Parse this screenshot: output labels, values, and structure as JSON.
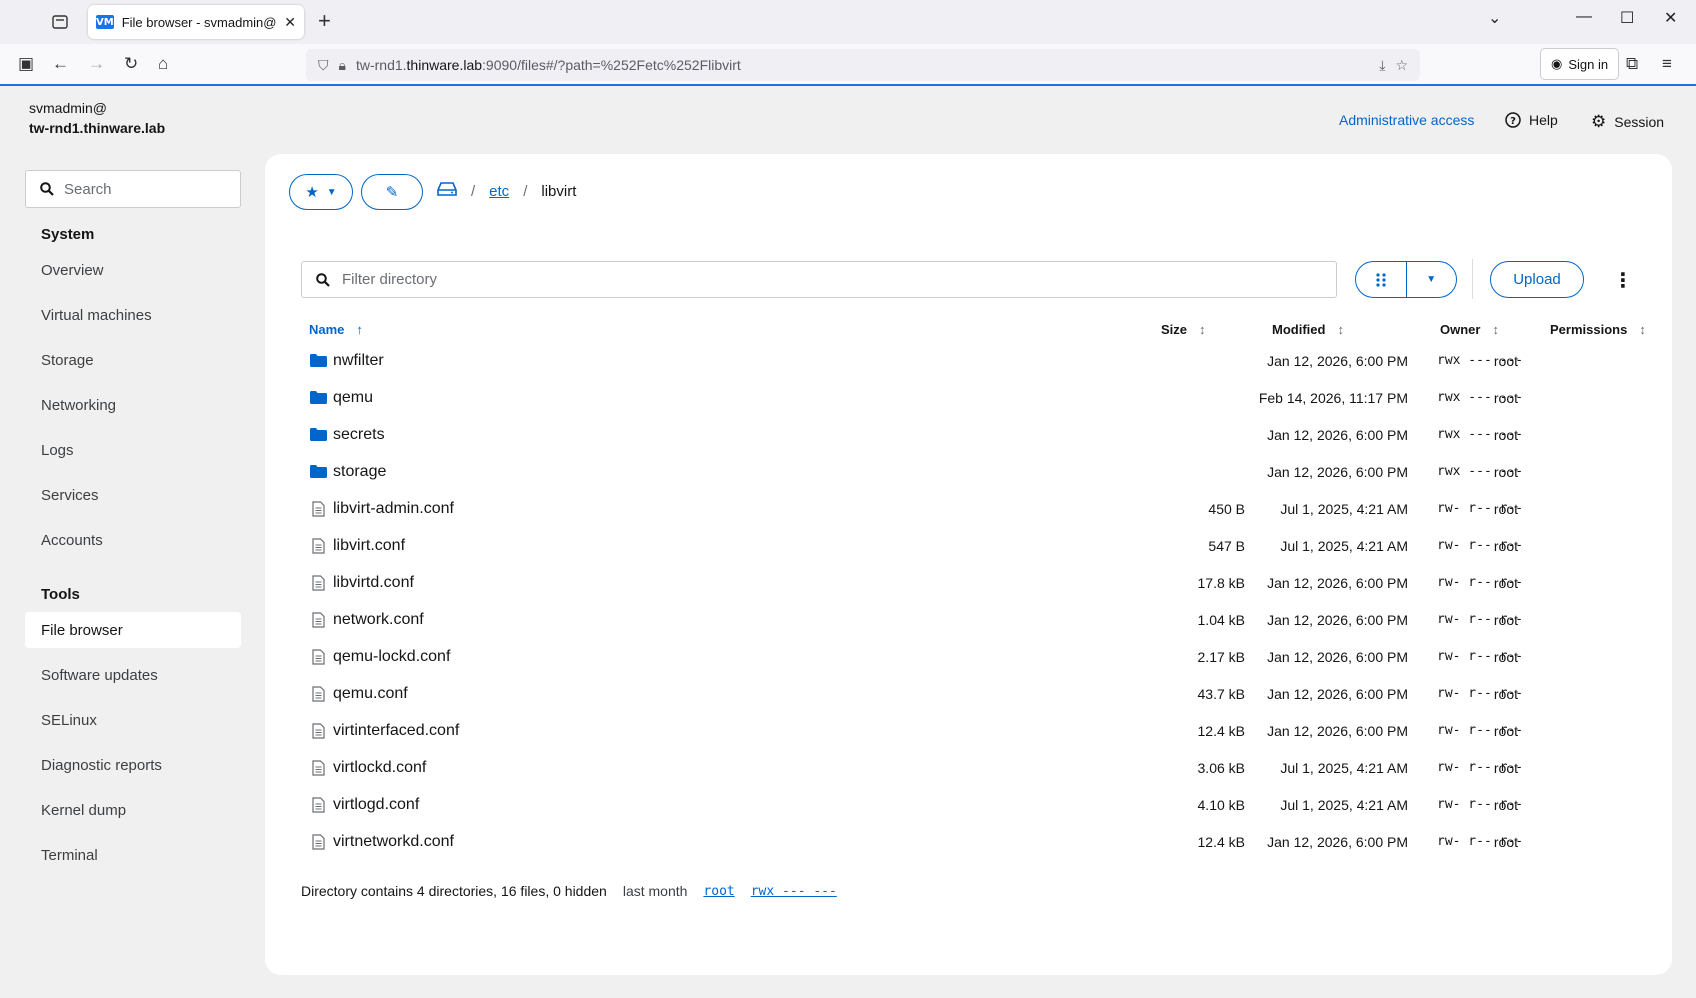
{
  "browser": {
    "tab_title": "File browser - svmadmin@tw-rr",
    "favicon_text": "VM",
    "url_prefix": "tw-rnd1.",
    "url_host": "thinware.lab",
    "url_rest": ":9090/files#/?path=%252Fetc%252Flibvirt",
    "signin_label": "Sign in"
  },
  "header": {
    "user": "svmadmin@",
    "host": "tw-rnd1.thinware.lab",
    "admin_access": "Administrative access",
    "help": "Help",
    "session": "Session"
  },
  "sidebar": {
    "search_placeholder": "Search",
    "system_label": "System",
    "system_items": [
      "Overview",
      "Virtual machines",
      "Storage",
      "Networking",
      "Logs",
      "Services",
      "Accounts"
    ],
    "tools_label": "Tools",
    "tools_items": [
      "File browser",
      "Software updates",
      "SELinux",
      "Diagnostic reports",
      "Kernel dump",
      "Terminal"
    ],
    "active_item": "File browser"
  },
  "breadcrumb": {
    "segments": [
      "etc",
      "libvirt"
    ]
  },
  "toolbar": {
    "filter_placeholder": "Filter directory",
    "upload_label": "Upload"
  },
  "table": {
    "headers": {
      "name": "Name",
      "size": "Size",
      "modified": "Modified",
      "owner": "Owner",
      "permissions": "Permissions"
    },
    "rows": [
      {
        "type": "folder",
        "name": "nwfilter",
        "size": "",
        "modified": "Jan 12, 2026, 6:00 PM",
        "owner": "root",
        "perm": "rwx --- ---"
      },
      {
        "type": "folder",
        "name": "qemu",
        "size": "",
        "modified": "Feb 14, 2026, 11:17 PM",
        "owner": "root",
        "perm": "rwx --- ---"
      },
      {
        "type": "folder",
        "name": "secrets",
        "size": "",
        "modified": "Jan 12, 2026, 6:00 PM",
        "owner": "root",
        "perm": "rwx --- ---"
      },
      {
        "type": "folder",
        "name": "storage",
        "size": "",
        "modified": "Jan 12, 2026, 6:00 PM",
        "owner": "root",
        "perm": "rwx --- ---"
      },
      {
        "type": "file",
        "name": "libvirt-admin.conf",
        "size": "450 B",
        "modified": "Jul 1, 2025, 4:21 AM",
        "owner": "root",
        "perm": "rw- r-- r--"
      },
      {
        "type": "file",
        "name": "libvirt.conf",
        "size": "547 B",
        "modified": "Jul 1, 2025, 4:21 AM",
        "owner": "root",
        "perm": "rw- r-- r--"
      },
      {
        "type": "file",
        "name": "libvirtd.conf",
        "size": "17.8 kB",
        "modified": "Jan 12, 2026, 6:00 PM",
        "owner": "root",
        "perm": "rw- r-- r--"
      },
      {
        "type": "file",
        "name": "network.conf",
        "size": "1.04 kB",
        "modified": "Jan 12, 2026, 6:00 PM",
        "owner": "root",
        "perm": "rw- r-- r--"
      },
      {
        "type": "file",
        "name": "qemu-lockd.conf",
        "size": "2.17 kB",
        "modified": "Jan 12, 2026, 6:00 PM",
        "owner": "root",
        "perm": "rw- r-- r--"
      },
      {
        "type": "file",
        "name": "qemu.conf",
        "size": "43.7 kB",
        "modified": "Jan 12, 2026, 6:00 PM",
        "owner": "root",
        "perm": "rw- r-- r--"
      },
      {
        "type": "file",
        "name": "virtinterfaced.conf",
        "size": "12.4 kB",
        "modified": "Jan 12, 2026, 6:00 PM",
        "owner": "root",
        "perm": "rw- r-- r--"
      },
      {
        "type": "file",
        "name": "virtlockd.conf",
        "size": "3.06 kB",
        "modified": "Jul 1, 2025, 4:21 AM",
        "owner": "root",
        "perm": "rw- r-- r--"
      },
      {
        "type": "file",
        "name": "virtlogd.conf",
        "size": "4.10 kB",
        "modified": "Jul 1, 2025, 4:21 AM",
        "owner": "root",
        "perm": "rw- r-- r--"
      },
      {
        "type": "file",
        "name": "virtnetworkd.conf",
        "size": "12.4 kB",
        "modified": "Jan 12, 2026, 6:00 PM",
        "owner": "root",
        "perm": "rw- r-- r--"
      }
    ]
  },
  "footer": {
    "summary": "Directory contains 4 directories, 16 files, 0 hidden",
    "modified": "last month",
    "owner": "root",
    "perm": "rwx --- ---"
  },
  "colors": {
    "accent": "#0066cc",
    "folder": "#0066cc",
    "browser_accent": "#1a73e8"
  }
}
